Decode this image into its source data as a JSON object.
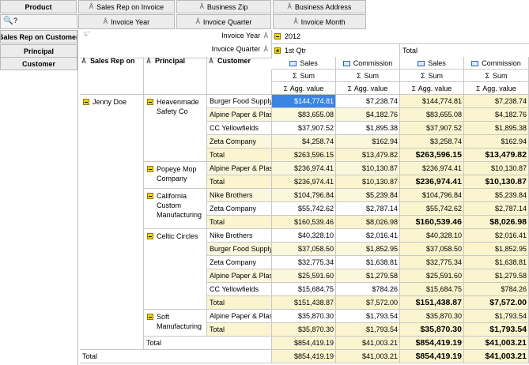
{
  "top_fields": [
    "Product",
    "Sales Rep on Invoice",
    "Business Zip",
    "Business Address"
  ],
  "col_fields": [
    "Invoice Year",
    "Invoice Quarter",
    "Invoice Month"
  ],
  "row_fields": [
    "Sales Rep on Customer",
    "Principal",
    "Customer"
  ],
  "filter_icon_label": "?",
  "col_axis": {
    "year_label": "Invoice Year",
    "year_value": "2012",
    "quarter_label": "Invoice Quarter",
    "quarter_value": "1st Qtr",
    "total_label": "Total"
  },
  "row_headers": {
    "rep": "Sales Rep on",
    "principal": "Principal",
    "customer": "Customer"
  },
  "measure_headers": [
    {
      "name": "Sales",
      "agg": "Sum",
      "value": "Agg. value"
    },
    {
      "name": "Commission",
      "agg": "Sum",
      "value": "Agg. value"
    },
    {
      "name": "Sales",
      "agg": "Sum",
      "value": "Agg. value"
    },
    {
      "name": "Commission",
      "agg": "Sum",
      "value": "Agg. value"
    }
  ],
  "sigma": "Σ",
  "rep_name": "Jenny Doe",
  "groups": [
    {
      "principal": "Heavenmade Safety Co",
      "rows": [
        {
          "customer": "Burger Food Supply",
          "v": [
            "$144,774.81",
            "$7,238.74",
            "$144,774.81",
            "$7,238.74"
          ]
        },
        {
          "customer": "Alpine Paper & Plast",
          "v": [
            "$83,655.08",
            "$4,182.76",
            "$83,655.08",
            "$4,182.76"
          ]
        },
        {
          "customer": "CC Yellowfields",
          "v": [
            "$37,907.52",
            "$1,895.38",
            "$37,907.52",
            "$1,895.38"
          ]
        },
        {
          "customer": "Zeta Company",
          "v": [
            "$4,258.74",
            "$162.94",
            "$3,258.74",
            "$162.94"
          ]
        }
      ],
      "total": [
        "$263,596.15",
        "$13,479.82",
        "$263,596.15",
        "$13,479.82"
      ]
    },
    {
      "principal": "Popeye Mop Company",
      "rows": [
        {
          "customer": "Alpine Paper & Plast",
          "v": [
            "$236,974.41",
            "$10,130.87",
            "$236,974.41",
            "$10,130.87"
          ]
        }
      ],
      "total": [
        "$236,974.41",
        "$10,130.87",
        "$236,974.41",
        "$10,130.87"
      ]
    },
    {
      "principal": "California Custom Manufacturing",
      "rows": [
        {
          "customer": "Nike Brothers",
          "v": [
            "$104,796.84",
            "$5,239.84",
            "$104,796.84",
            "$5,239.84"
          ]
        },
        {
          "customer": "Zeta Company",
          "v": [
            "$55,742.62",
            "$2,787.14",
            "$55,742.62",
            "$2,787.14"
          ]
        }
      ],
      "total": [
        "$160,539.46",
        "$8,026.98",
        "$160,539.46",
        "$8,026.98"
      ]
    },
    {
      "principal": "Celtic Circles",
      "rows": [
        {
          "customer": "Nike Brothers",
          "v": [
            "$40,328.10",
            "$2,016.41",
            "$40,328.10",
            "$2,016.41"
          ]
        },
        {
          "customer": "Burger Food Supply",
          "v": [
            "$37,058.50",
            "$1,852.95",
            "$37,058.50",
            "$1,852.95"
          ]
        },
        {
          "customer": "Zeta Company",
          "v": [
            "$32,775.34",
            "$1,638.81",
            "$32,775.34",
            "$1,638.81"
          ]
        },
        {
          "customer": "Alpine Paper & Plast",
          "v": [
            "$25,591.60",
            "$1,279.58",
            "$25,591.60",
            "$1,279.58"
          ]
        },
        {
          "customer": "CC Yellowfields",
          "v": [
            "$15,684.75",
            "$784.26",
            "$15,684.75",
            "$784.26"
          ]
        }
      ],
      "total": [
        "$151,438.87",
        "$7,572.00",
        "$151,438.87",
        "$7,572.00"
      ]
    },
    {
      "principal": "Soft Manufacturing",
      "rows": [
        {
          "customer": "Alpine Paper & Plast",
          "v": [
            "$35,870.30",
            "$1,793.54",
            "$35,870.30",
            "$1,793.54"
          ]
        }
      ],
      "total": [
        "$35,870.30",
        "$1,793.54",
        "$35,870.30",
        "$1,793.54"
      ]
    }
  ],
  "total_label": "Total",
  "rep_total": [
    "$854,419.19",
    "$41,003.21",
    "$854,419.19",
    "$41,003.21"
  ],
  "grand_total_label": "Total",
  "grand_total": [
    "$854,419.19",
    "$41,003.21",
    "$854,419.19",
    "$41,003.21"
  ]
}
